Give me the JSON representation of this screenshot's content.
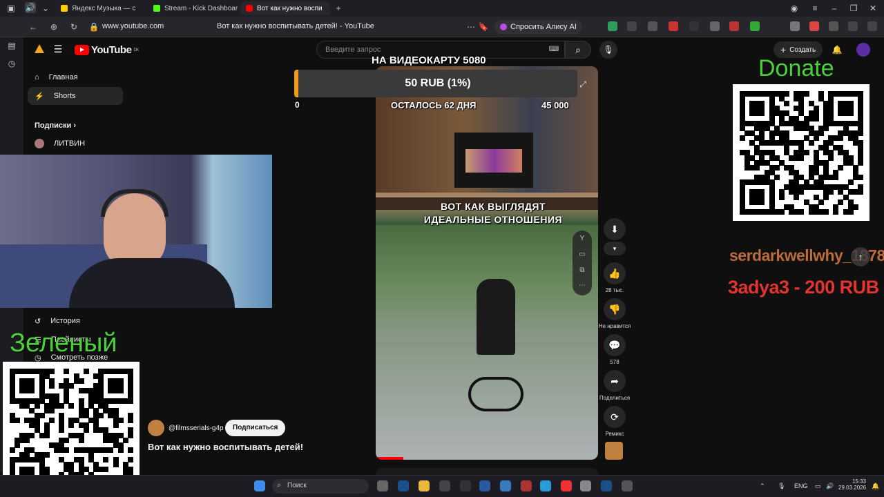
{
  "browser": {
    "tabs": [
      {
        "label": "Яндекс Музыка — с",
        "color": "#ffcc00"
      },
      {
        "label": "Stream - Kick Dashboard",
        "color": "#53fc18"
      },
      {
        "label": "Вот как нужно воспи",
        "color": "#ff0000"
      }
    ],
    "tab_count_badge": "3",
    "url": "www.youtube.com",
    "page_title": "Вот как нужно воспитывать детей! - YouTube",
    "alice_label": "Спросить Алису AI"
  },
  "youtube": {
    "logo": "YouTube",
    "region": "DK",
    "search_placeholder": "Введите запрос",
    "create_label": "Создать",
    "nav": {
      "home": "Главная",
      "shorts": "Shorts",
      "subs_header": "Подписки",
      "sub1": "ЛИТВИН",
      "history": "История",
      "playlists": "Плейлисты",
      "watch_later": "Смотреть позже"
    },
    "channel": "@filmsserials-g4p",
    "subscribe_label": "Подписаться",
    "video_title": "Вот как нужно воспитывать детей!",
    "actions": {
      "likes": "28 тыс.",
      "dislike": "Не нравится",
      "comments": "578",
      "share": "Поделиться",
      "remix": "Ремикс"
    }
  },
  "overlay": {
    "goal_title": "НА ВИДЕОКАРТУ 5080",
    "goal_progress": "50 RUB (1%)",
    "goal_min": "0",
    "goal_left": "ОСТАЛОСЬ 62 ДНЯ",
    "goal_max": "45 000",
    "caption": "ВОТ КАК ВЫГЛЯДЯТ ИДЕАЛЬНЫЕ ОТНОШЕНИЯ",
    "donate": "Donate",
    "zeleny": "Зеленый",
    "scroll_name": "serdarkwellwhy_1878",
    "last_donation": "3adya3 - 200 RUB"
  },
  "taskbar": {
    "search": "Поиск",
    "lang": "ENG",
    "time": "15:33",
    "date": "29.03.2026"
  },
  "colors": {
    "accent_green": "#4ad13a",
    "yt_red": "#ff0000",
    "donation_red": "#e3342f"
  }
}
